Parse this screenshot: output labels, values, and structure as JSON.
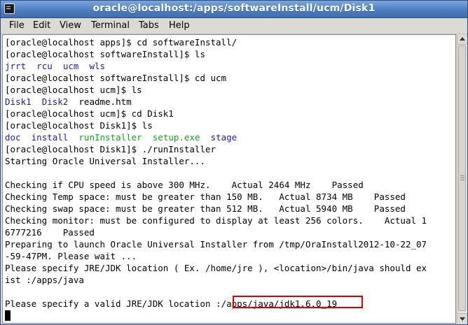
{
  "window": {
    "title": "oracle@localhost:/apps/softwareInstall/ucm/Disk1"
  },
  "menu": {
    "file": "File",
    "edit": "Edit",
    "view": "View",
    "terminal": "Terminal",
    "tabs": "Tabs",
    "help": "Help"
  },
  "terminal": {
    "l01": "[oracle@localhost apps]$ cd softwareInstall/",
    "l02": "[oracle@localhost softwareInstall]$ ls",
    "l03": {
      "a": "jrrt",
      "b": "rcu",
      "c": "ucm",
      "d": "wls"
    },
    "l04": "[oracle@localhost softwareInstall]$ cd ucm",
    "l05": "[oracle@localhost ucm]$ ls",
    "l06": {
      "a": "Disk1",
      "b": "Disk2",
      "c": "readme.htm"
    },
    "l07": "[oracle@localhost ucm]$ cd Disk1",
    "l08": "[oracle@localhost Disk1]$ ls",
    "l09": {
      "a": "doc",
      "b": "install",
      "c": "runInstaller",
      "d": "setup.exe",
      "e": "stage"
    },
    "l10": "[oracle@localhost Disk1]$ ./runInstaller",
    "l11": "Starting Oracle Universal Installer...",
    "l12": "",
    "l13": "Checking if CPU speed is above 300 MHz.    Actual 2464 MHz    Passed",
    "l14": "Checking Temp space: must be greater than 150 MB.   Actual 8734 MB    Passed",
    "l15": "Checking swap space: must be greater than 512 MB.   Actual 5940 MB    Passed",
    "l16": "Checking monitor: must be configured to display at least 256 colors.    Actual 1",
    "l17": "6777216    Passed",
    "l18": "Preparing to launch Oracle Universal Installer from /tmp/OraInstall2012-10-22_07",
    "l19": "-59-47PM. Please wait ...",
    "l20": "Please specify JRE/JDK location ( Ex. /home/jre ), <location>/bin/java should ex",
    "l21": "ist :/apps/java",
    "l22": "",
    "l23": "Please specify a valid JRE/JDK location :/apps/java/jdk1.6.0_19"
  },
  "colors": {
    "dir": "#1c1ca8",
    "executable": "#17a317",
    "highlight_box": "#e00000",
    "titlebar": "#4d7fc0"
  }
}
